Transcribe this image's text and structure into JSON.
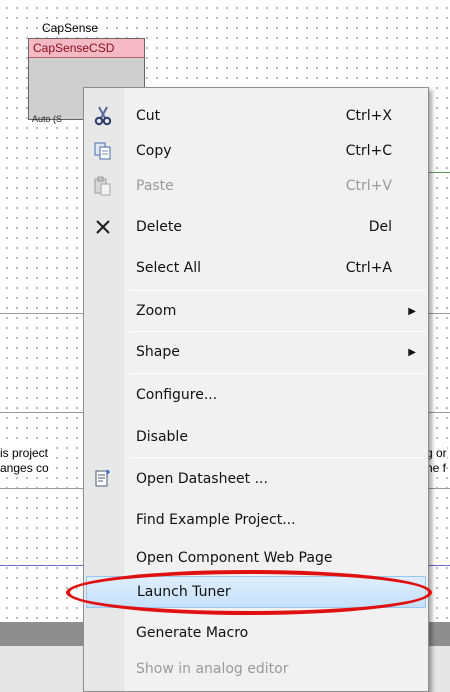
{
  "component": {
    "title": "CapSense",
    "name": "CapSenseCSD",
    "footer": "Auto (S"
  },
  "background_texts": {
    "left1": "is project",
    "left2": "anges co",
    "right1": "g or",
    "right2": "he f"
  },
  "menu": {
    "cut": {
      "label": "Cut",
      "shortcut": "Ctrl+X"
    },
    "copy": {
      "label": "Copy",
      "shortcut": "Ctrl+C"
    },
    "paste": {
      "label": "Paste",
      "shortcut": "Ctrl+V"
    },
    "delete": {
      "label": "Delete",
      "shortcut": "Del"
    },
    "select_all": {
      "label": "Select All",
      "shortcut": "Ctrl+A"
    },
    "zoom": {
      "label": "Zoom"
    },
    "shape": {
      "label": "Shape"
    },
    "configure": {
      "label": "Configure..."
    },
    "disable": {
      "label": "Disable"
    },
    "open_datasheet": {
      "label": "Open Datasheet ..."
    },
    "find_example": {
      "label": "Find Example Project..."
    },
    "open_web_page": {
      "label": "Open Component Web Page"
    },
    "launch_tuner": {
      "label": "Launch Tuner"
    },
    "generate_macro": {
      "label": "Generate Macro"
    },
    "show_analog": {
      "label": "Show in analog editor"
    }
  },
  "colors": {
    "highlight": "#c6e0fa",
    "annotation": "#e01010",
    "component_header": "#f5b8c5"
  }
}
